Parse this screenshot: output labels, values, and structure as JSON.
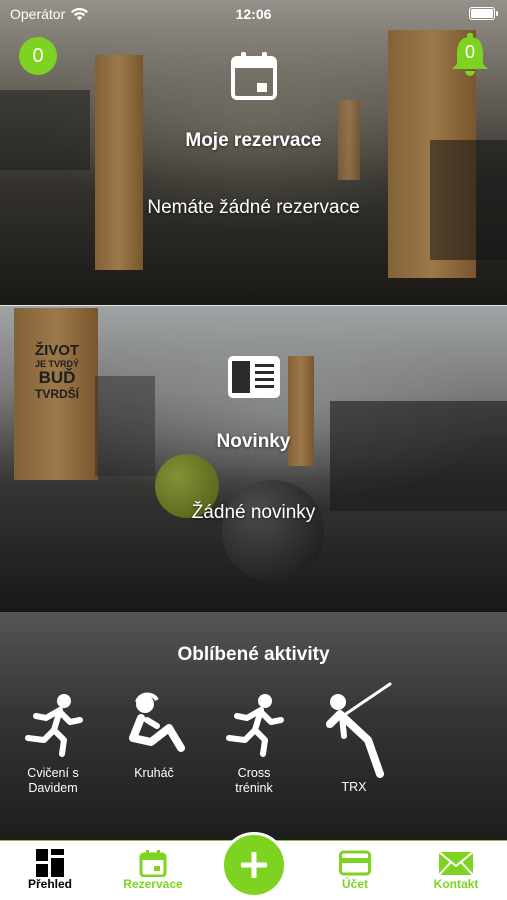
{
  "status_bar": {
    "carrier": "Operátor",
    "time": "12:06"
  },
  "badges": {
    "left_count": "0",
    "notifications_count": "0"
  },
  "reservations": {
    "title": "Moje rezervace",
    "text": "Nemáte žádné rezervace",
    "icon": "calendar-icon"
  },
  "news": {
    "title": "Novinky",
    "text": "Žádné novinky",
    "icon": "news-icon"
  },
  "wall_text": {
    "line1": "ŽIVOT",
    "line2": "JE TVRDÝ",
    "line3": "BUĎ",
    "line4": "TVRDŠÍ"
  },
  "favorites": {
    "title": "Oblíbené aktivity",
    "items": [
      {
        "label_line1": "Cvičení s",
        "label_line2": "Davidem",
        "icon": "running-icon"
      },
      {
        "label_line1": "Kruháč",
        "label_line2": "",
        "icon": "situp-icon"
      },
      {
        "label_line1": "Cross",
        "label_line2": "trénink",
        "icon": "running-icon"
      },
      {
        "label_line1": "TRX",
        "label_line2": "",
        "icon": "trx-icon"
      }
    ]
  },
  "tabbar": {
    "overview": "Přehled",
    "reservations": "Rezervace",
    "account": "Účet",
    "contact": "Kontakt"
  },
  "colors": {
    "accent": "#7ed321",
    "tab_border": "#8bc53f"
  }
}
